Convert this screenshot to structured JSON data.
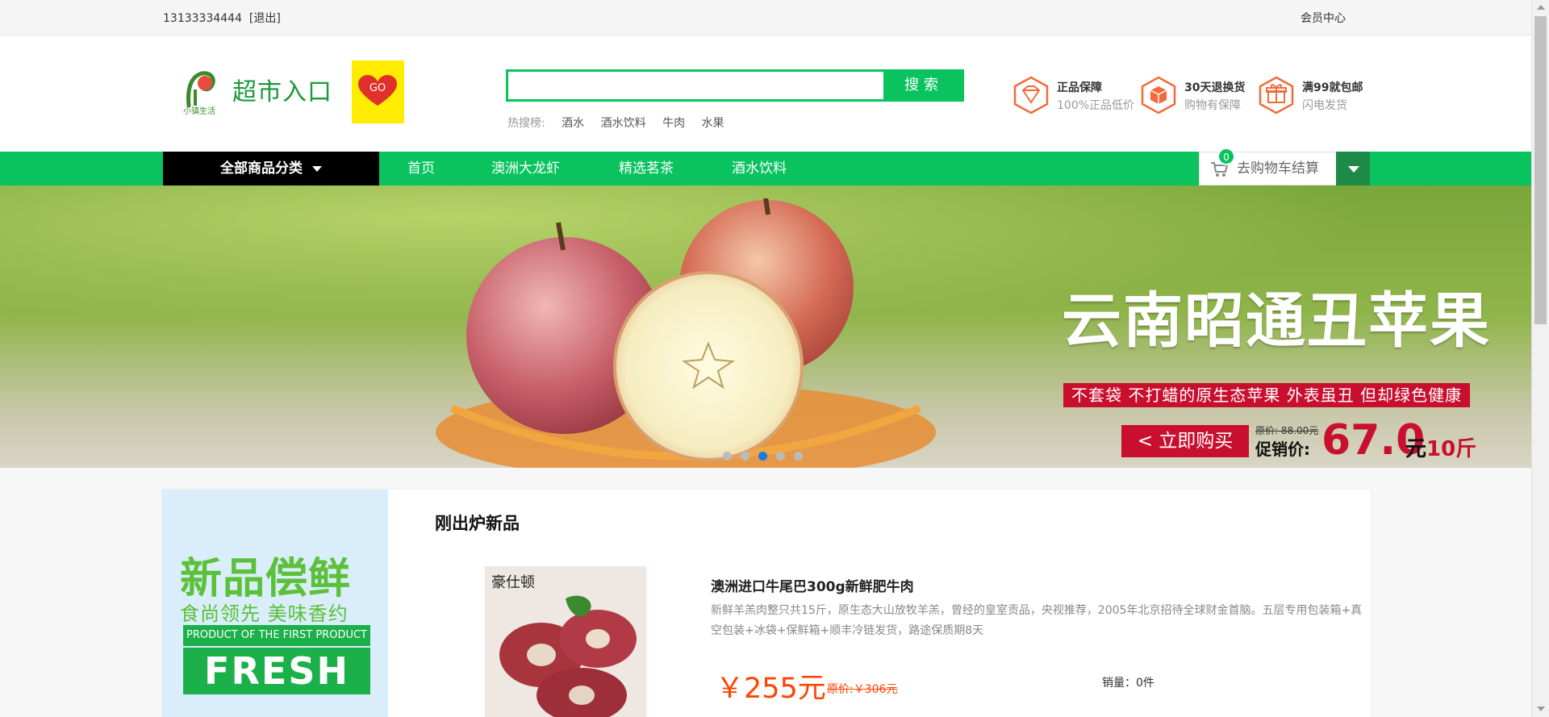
{
  "topbar": {
    "phone": "13133334444",
    "logout_open": "[",
    "logout": "退出",
    "logout_close": "]",
    "member_center": "会员中心"
  },
  "header": {
    "logo_title": "超市入口",
    "logo_small": "小镇生活",
    "logo_go": "GO",
    "search": {
      "placeholder": "",
      "button": "搜索"
    },
    "hot": {
      "label": "热搜榜:",
      "items": [
        "酒水",
        "酒水饮料",
        "牛肉",
        "水果"
      ]
    },
    "promises": [
      {
        "title": "正品保障",
        "sub": "100%正品低价",
        "icon": "diamond-icon"
      },
      {
        "title": "30天退换货",
        "sub": "购物有保障",
        "icon": "box-icon"
      },
      {
        "title": "满99就包邮",
        "sub": "闪电发货",
        "icon": "gift-icon"
      }
    ]
  },
  "nav": {
    "all_categories": "全部商品分类",
    "links": [
      "首页",
      "澳洲大龙虾",
      "精选茗茶",
      "酒水饮料"
    ],
    "cart_label": "去购物车结算",
    "cart_count": "0"
  },
  "banner": {
    "headline": "云南昭通丑苹果",
    "subline": "不套袋  不打蜡的原生态苹果  外表虽丑  但却绿色健康",
    "buy_button": "< 立即购买",
    "original_price": "原价: 88.00元",
    "promo_label": "促销价:",
    "promo_price": "67.0",
    "promo_unit_a": "元",
    "promo_unit_b": "10斤",
    "slides": 5,
    "active_slide": 3
  },
  "section": {
    "title": "刚出炉新品",
    "side": {
      "big": "新品偿鲜",
      "mid": "食尚领先  美味香约",
      "en1": "PRODUCT OF THE FIRST PRODUCT",
      "en2": "FRESH"
    },
    "product": {
      "name": "澳洲进口牛尾巴300g新鲜肥牛肉",
      "desc": "新鲜羊羔肉整只共15斤，原生态大山放牧羊羔，曾经的皇室贡品，央视推荐，2005年北京招待全球财金首脑。五层专用包装箱+真空包装+冰袋+保鲜箱+顺丰冷链发货，路途保质期8天",
      "price": "￥255元",
      "old_price": "原价:￥306元",
      "sales": "销量：0件",
      "image_label": "豪仕顿"
    }
  },
  "colors": {
    "accent": "#0ac35f",
    "dark_accent": "#1e8a47",
    "price": "#ff4400",
    "banner_red": "#c8102e"
  }
}
